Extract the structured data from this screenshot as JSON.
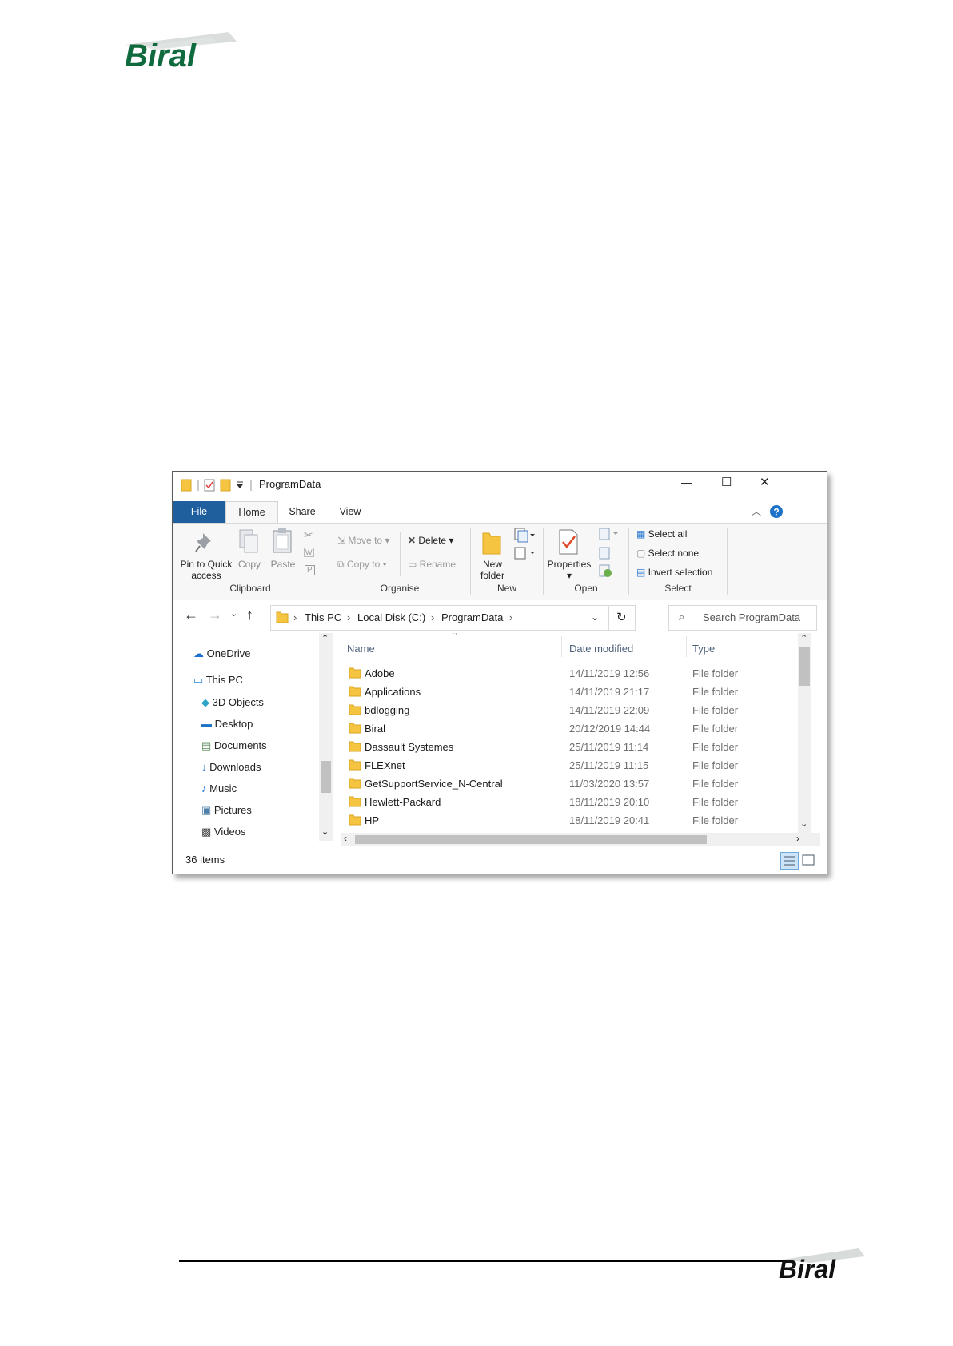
{
  "document": {
    "logo_text": "Biral"
  },
  "window": {
    "title": "ProgramData",
    "controls": {
      "minimize": "—",
      "maximize": "☐",
      "close": "✕"
    }
  },
  "ribbon": {
    "tabs": [
      "File",
      "Home",
      "Share",
      "View"
    ],
    "clipboard": {
      "pin": "Pin to Quick access",
      "pin_line1": "Pin to Quick",
      "pin_line2": "access",
      "copy": "Copy",
      "paste": "Paste",
      "label": "Clipboard"
    },
    "organise": {
      "move_to": "Move to",
      "copy_to": "Copy to",
      "delete": "Delete",
      "rename": "Rename",
      "label": "Organise"
    },
    "new": {
      "new_folder_line1": "New",
      "new_folder_line2": "folder",
      "label": "New"
    },
    "open": {
      "properties": "Properties",
      "label": "Open"
    },
    "select": {
      "select_all": "Select all",
      "select_none": "Select none",
      "invert_selection": "Invert selection",
      "label": "Select"
    }
  },
  "address": {
    "crumbs": [
      "This PC",
      "Local Disk (C:)",
      "ProgramData"
    ],
    "search_placeholder": "Search ProgramData"
  },
  "nav": {
    "items": [
      {
        "label": "OneDrive",
        "icon": "onedrive-icon"
      },
      {
        "label": "This PC",
        "icon": "computer-icon"
      },
      {
        "label": "3D Objects",
        "icon": "3d-objects-icon"
      },
      {
        "label": "Desktop",
        "icon": "desktop-icon"
      },
      {
        "label": "Documents",
        "icon": "documents-icon"
      },
      {
        "label": "Downloads",
        "icon": "downloads-icon"
      },
      {
        "label": "Music",
        "icon": "music-icon"
      },
      {
        "label": "Pictures",
        "icon": "pictures-icon"
      },
      {
        "label": "Videos",
        "icon": "videos-icon"
      }
    ]
  },
  "files": {
    "columns": [
      "Name",
      "Date modified",
      "Type"
    ],
    "rows": [
      {
        "name": "Adobe",
        "date": "14/11/2019 12:56",
        "type": "File folder"
      },
      {
        "name": "Applications",
        "date": "14/11/2019 21:17",
        "type": "File folder"
      },
      {
        "name": "bdlogging",
        "date": "14/11/2019 22:09",
        "type": "File folder"
      },
      {
        "name": "Biral",
        "date": "20/12/2019 14:44",
        "type": "File folder"
      },
      {
        "name": "Dassault Systemes",
        "date": "25/11/2019 11:14",
        "type": "File folder"
      },
      {
        "name": "FLEXnet",
        "date": "25/11/2019 11:15",
        "type": "File folder"
      },
      {
        "name": "GetSupportService_N-Central",
        "date": "11/03/2020 13:57",
        "type": "File folder"
      },
      {
        "name": "Hewlett-Packard",
        "date": "18/11/2019 20:10",
        "type": "File folder"
      },
      {
        "name": "HP",
        "date": "18/11/2019 20:41",
        "type": "File folder"
      }
    ]
  },
  "status": {
    "item_count": "36 items"
  },
  "colors": {
    "brand_green": "#0f6b3e",
    "file_tab": "#1f5f9e",
    "folder": "#f5c542",
    "help": "#1e73c8"
  }
}
